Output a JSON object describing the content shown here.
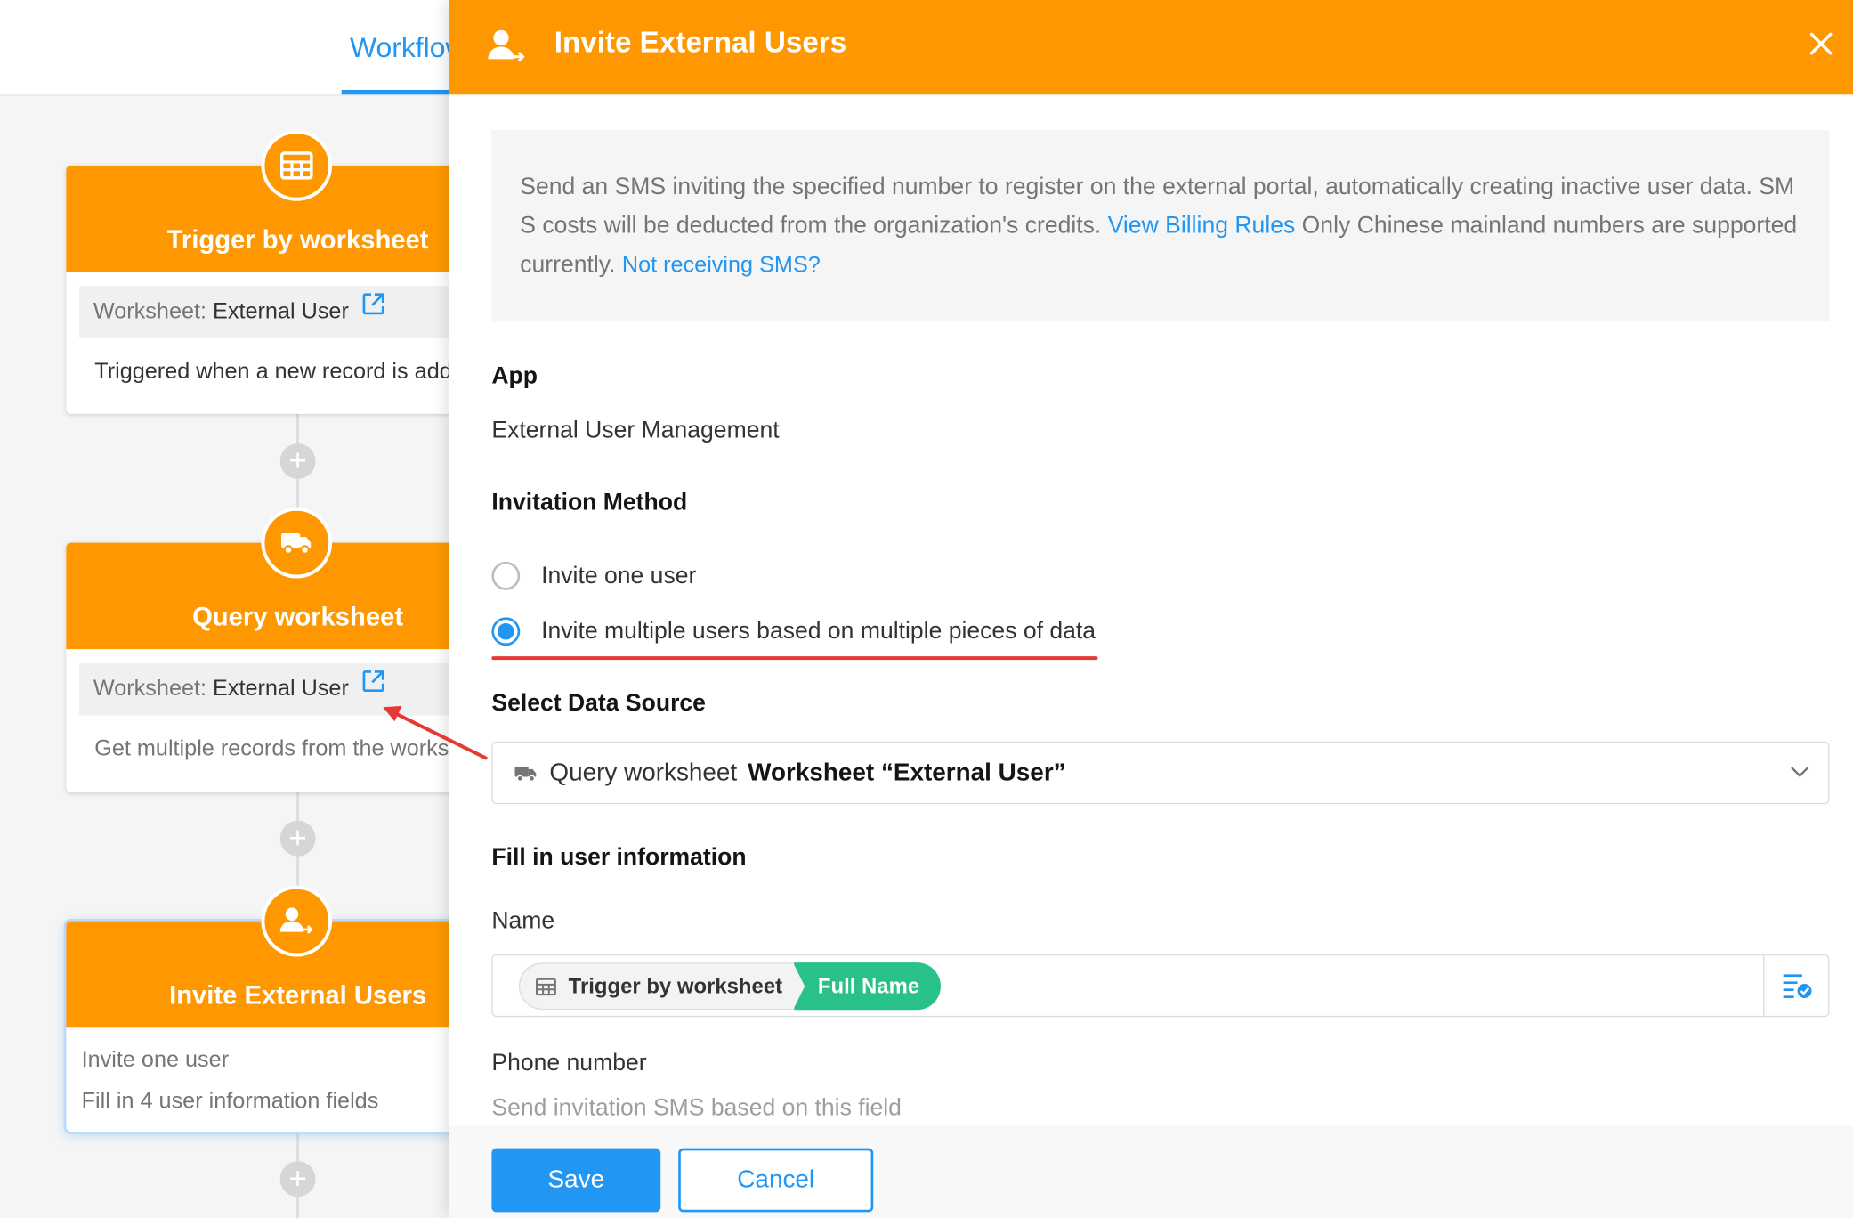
{
  "canvas": {
    "tab_label": "Workflow",
    "nodes": [
      {
        "title": "Trigger by worksheet",
        "icon": "table-icon",
        "worksheet_prefix": "Worksheet:",
        "worksheet_name": "External User",
        "description": "Triggered when a new record is added"
      },
      {
        "title": "Query worksheet",
        "icon": "truck-icon",
        "worksheet_prefix": "Worksheet:",
        "worksheet_name": "External User",
        "description": "Get multiple records from the worksheet"
      },
      {
        "title": "Invite External Users",
        "icon": "invite-user-icon",
        "lines": [
          "Invite one user",
          "Fill in 4 user information fields"
        ]
      }
    ]
  },
  "drawer": {
    "title": "Invite External Users",
    "info": {
      "text_1": "Send an SMS inviting the specified number to register on the external portal, automatically creating inactive user data. SMS costs will be deducted from the organization's credits.",
      "link_billing": "View Billing Rules",
      "text_2": "Only Chinese mainland numbers are supported currently.",
      "link_sms": "Not receiving SMS?"
    },
    "app_label": "App",
    "app_value": "External User Management",
    "method_label": "Invitation Method",
    "method_options": [
      "Invite one user",
      "Invite multiple users based on multiple pieces of data"
    ],
    "method_selected": 1,
    "data_source_label": "Select Data Source",
    "data_source_node": "Query worksheet",
    "data_source_worksheet": "Worksheet “External User”",
    "fill_label": "Fill in user information",
    "name_label": "Name",
    "name_tag_source": "Trigger by worksheet",
    "name_tag_field": "Full Name",
    "phone_label": "Phone number",
    "phone_hint": "Send invitation SMS based on this field",
    "save_label": "Save",
    "cancel_label": "Cancel"
  },
  "colors": {
    "accent_orange": "#ff9800",
    "primary_blue": "#2196f3",
    "tag_green": "#28c187",
    "annotation_red": "#e53935"
  }
}
